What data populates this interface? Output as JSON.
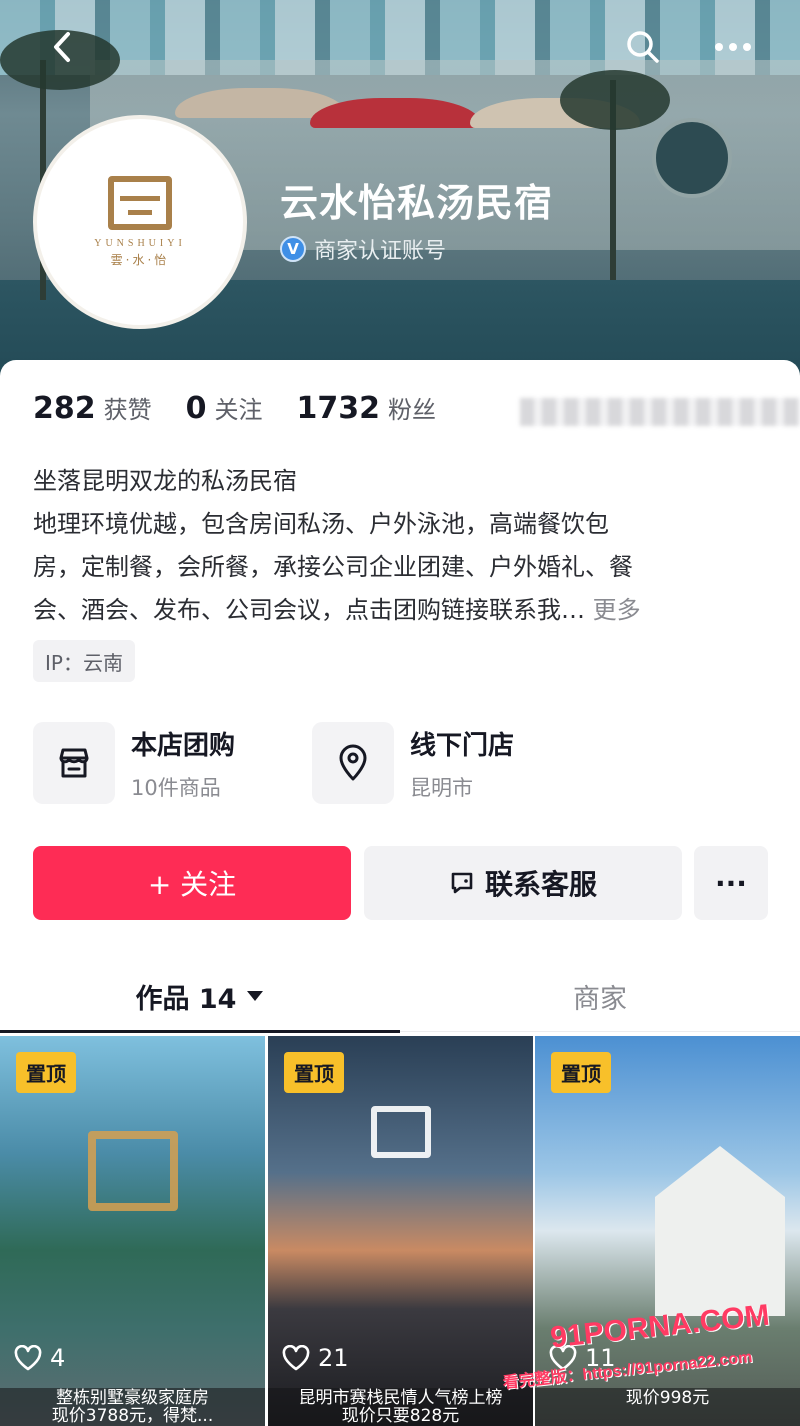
{
  "header": {
    "back_icon": "back-arrow-icon",
    "search_icon": "search-icon",
    "more_icon": "more-dots-icon",
    "shop_name": "云水怡私汤民宿",
    "verified_label": "商家认证账号",
    "avatar": {
      "logo_en": "YUNSHUIYI",
      "logo_cn": "雲·水·怡"
    }
  },
  "stats": [
    {
      "value": "282",
      "label": "获赞"
    },
    {
      "value": "0",
      "label": "关注"
    },
    {
      "value": "1732",
      "label": "粉丝"
    }
  ],
  "bio": {
    "line1": "坐落昆明双龙的私汤民宿",
    "line2": "地理环境优越，包含房间私汤、户外泳池，高端餐饮包",
    "line3": "房，定制餐，会所餐，承接公司企业团建、户外婚礼、餐",
    "line4": "会、酒会、发布、公司会议，点击团购链接联系我…",
    "more": "更多"
  },
  "ip_tag": "IP：云南",
  "entries": [
    {
      "title": "本店团购",
      "subtitle": "10件商品",
      "icon": "store-icon"
    },
    {
      "title": "线下门店",
      "subtitle": "昆明市",
      "icon": "location-pin-icon"
    }
  ],
  "actions": {
    "follow": "+ 关注",
    "contact": "联系客服",
    "more": "···"
  },
  "tabs": {
    "works": "作品 14",
    "shop": "商家"
  },
  "videos": [
    {
      "pin": "置顶",
      "likes": "4",
      "caption_line1": "整栋别墅豪级家庭房",
      "caption_line2": "现价3788元，得梵..."
    },
    {
      "pin": "置顶",
      "likes": "21",
      "caption_line1": "昆明市赛栈民情人气榜上榜",
      "caption_line2": "现价只要828元"
    },
    {
      "pin": "置顶",
      "likes": "11",
      "caption_line1": "",
      "caption_line2": "现价998元"
    }
  ],
  "watermark": {
    "line1": "91PORNA.COM",
    "line2": "看完整版：https://91porna22.com"
  },
  "colors": {
    "follow_button": "#fe2c55",
    "pin_badge": "#f8c02a",
    "verified": "#3f8fe6",
    "brand_gold": "#a9804a"
  }
}
